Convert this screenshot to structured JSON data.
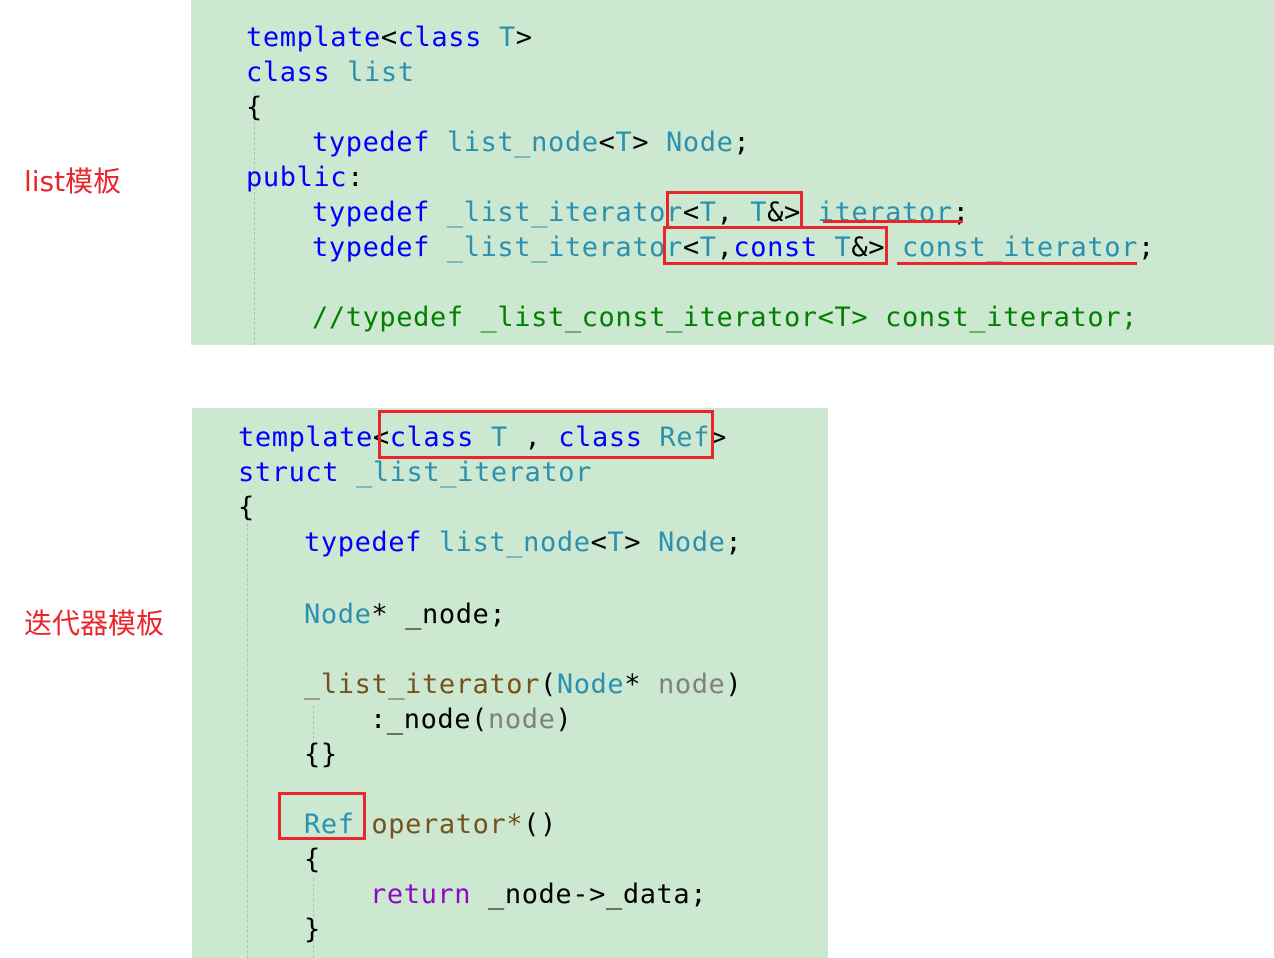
{
  "labels": {
    "list_template": "list模板",
    "iterator_template": "迭代器模板"
  },
  "top_code": {
    "l1": {
      "a": "template",
      "b": "<",
      "c": "class",
      "d": " T",
      "e": ">"
    },
    "l2": {
      "a": "class",
      "b": " list"
    },
    "l3": {
      "a": "{"
    },
    "l4": {
      "a": "typedef",
      "b": " list_node",
      "c": "<",
      "d": "T",
      "e": "> ",
      "f": "Node",
      "g": ";"
    },
    "l5": {
      "a": "public",
      "b": ":"
    },
    "l6": {
      "a": "typedef",
      "b": " _list_iterator",
      "c": "<",
      "d": "T",
      "e": ", ",
      "f": "T",
      "g": "&> ",
      "h": "iterator",
      "i": ";"
    },
    "l7": {
      "a": "typedef",
      "b": " _list_iterator",
      "c": "<",
      "d": "T",
      "e": ",",
      "f": "const",
      "g": " T",
      "h": "&> ",
      "i": "const_iterator",
      "j": ";"
    },
    "l8": {
      "a": "//typedef _list_const_iterator<T> const_iterator;"
    }
  },
  "bottom_code": {
    "l1": {
      "a": "template",
      "b": "<",
      "c": "class",
      "d": " T",
      "e": " , ",
      "f": "class",
      "g": " Ref",
      "h": ">"
    },
    "l2": {
      "a": "struct",
      "b": " _list_iterator"
    },
    "l3": {
      "a": "{"
    },
    "l4": {
      "a": "typedef",
      "b": " list_node",
      "c": "<",
      "d": "T",
      "e": "> ",
      "f": "Node",
      "g": ";"
    },
    "l5": {
      "a": "Node",
      "b": "* _node;"
    },
    "l6": {
      "a": "_list_iterator",
      "b": "(",
      "c": "Node",
      "d": "* ",
      "e": "node",
      "f": ")"
    },
    "l7": {
      "a": ":_node(",
      "b": "node",
      "c": ")"
    },
    "l8": {
      "a": "{}"
    },
    "l9": {
      "a": "Ref",
      "b": " operator*",
      "c": "()"
    },
    "l10": {
      "a": "{"
    },
    "l11": {
      "a": "return",
      "b": " _node->_data;"
    },
    "l12": {
      "a": "}"
    }
  },
  "colors": {
    "panel_bg": "#cde8d1",
    "keyword": "#0000ff",
    "type": "#2b91af",
    "comment": "#008000",
    "function": "#74531f",
    "parameter": "#808080",
    "control": "#8f08c4",
    "annotation_red": "#e8262b"
  }
}
